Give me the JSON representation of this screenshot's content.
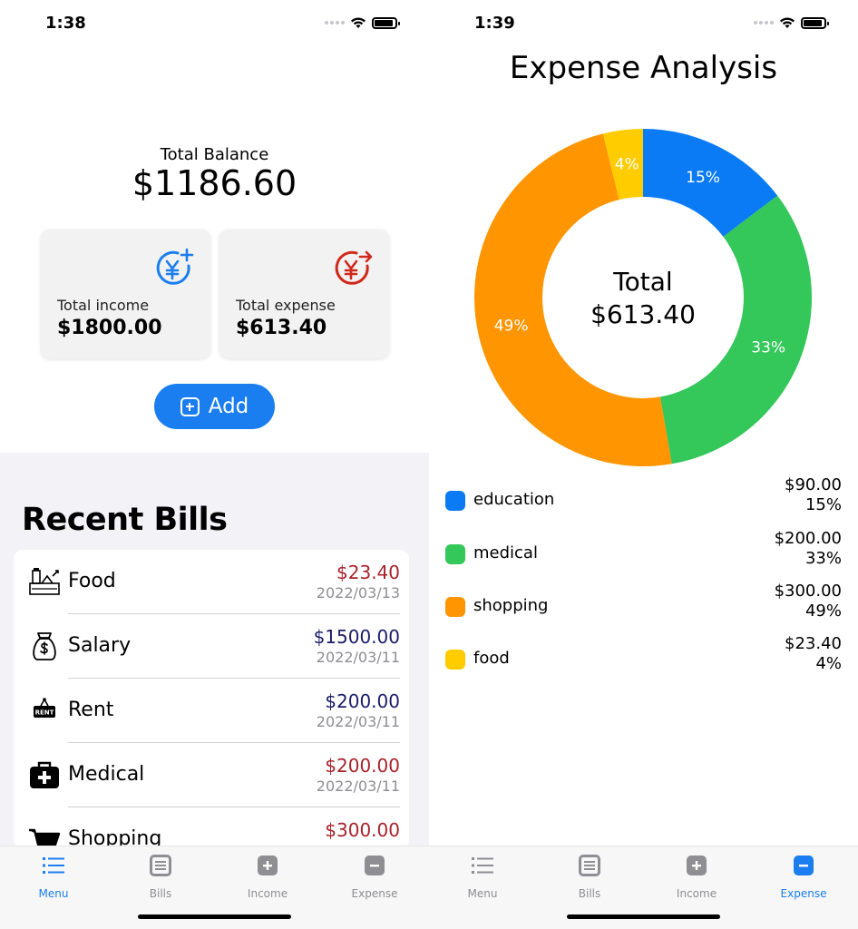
{
  "colors": {
    "accent": "#1a7ef0",
    "income_icon": "#1a7ef0",
    "expense_icon": "#d0281b",
    "expense_amount": "#a8232b",
    "income_amount": "#1c1c6b"
  },
  "left": {
    "status_time": "1:38",
    "balance": {
      "title": "Total Balance",
      "amount": "$1186.60"
    },
    "income_card": {
      "icon": "yen-plus-icon",
      "label": "Total income",
      "value": "$1800.00"
    },
    "expense_card": {
      "icon": "yen-arrow-icon",
      "label": "Total expense",
      "value": "$613.40"
    },
    "add_button": {
      "icon": "plus-square-icon",
      "label": "Add"
    },
    "recent_title": "Recent Bills",
    "bills": [
      {
        "icon": "grocery-icon",
        "name": "Food",
        "amount": "$23.40",
        "date": "2022/03/13",
        "type": "expense"
      },
      {
        "icon": "money-bag-icon",
        "name": "Salary",
        "amount": "$1500.00",
        "date": "2022/03/11",
        "type": "income"
      },
      {
        "icon": "rent-sign-icon",
        "name": "Rent",
        "amount": "$200.00",
        "date": "2022/03/11",
        "type": "income"
      },
      {
        "icon": "medical-kit-icon",
        "name": "Medical",
        "amount": "$200.00",
        "date": "2022/03/11",
        "type": "expense"
      },
      {
        "icon": "shopping-cart-icon",
        "name": "Shopping",
        "amount": "$300.00",
        "date": "",
        "type": "expense"
      }
    ],
    "tabs": [
      {
        "icon": "list-icon",
        "label": "Menu",
        "active": true
      },
      {
        "icon": "bills-icon",
        "label": "Bills",
        "active": false
      },
      {
        "icon": "plus-square-icon",
        "label": "Income",
        "active": false
      },
      {
        "icon": "minus-square-icon",
        "label": "Expense",
        "active": false
      }
    ]
  },
  "right": {
    "status_time": "1:39",
    "title": "Expense Analysis",
    "center_label": "Total",
    "center_value": "$613.40",
    "legend": [
      {
        "name": "education",
        "amount": "$90.00",
        "percent": "15%",
        "color": "#0a7bf4"
      },
      {
        "name": "medical",
        "amount": "$200.00",
        "percent": "33%",
        "color": "#34c759"
      },
      {
        "name": "shopping",
        "amount": "$300.00",
        "percent": "49%",
        "color": "#ff9500"
      },
      {
        "name": "food",
        "amount": "$23.40",
        "percent": "4%",
        "color": "#ffcc00"
      }
    ],
    "tabs": [
      {
        "icon": "list-icon",
        "label": "Menu",
        "active": false
      },
      {
        "icon": "bills-icon",
        "label": "Bills",
        "active": false
      },
      {
        "icon": "plus-square-icon",
        "label": "Income",
        "active": false
      },
      {
        "icon": "minus-square-icon",
        "label": "Expense",
        "active": true
      }
    ]
  },
  "chart_data": {
    "type": "pie",
    "title": "Expense Analysis",
    "categories": [
      "education",
      "medical",
      "shopping",
      "food"
    ],
    "values": [
      90.0,
      200.0,
      300.0,
      23.4
    ],
    "percent_labels": [
      "15%",
      "33%",
      "49%",
      "4%"
    ],
    "colors": [
      "#0a7bf4",
      "#34c759",
      "#ff9500",
      "#ffcc00"
    ],
    "center_text": [
      "Total",
      "$613.40"
    ],
    "legend_position": "below"
  }
}
